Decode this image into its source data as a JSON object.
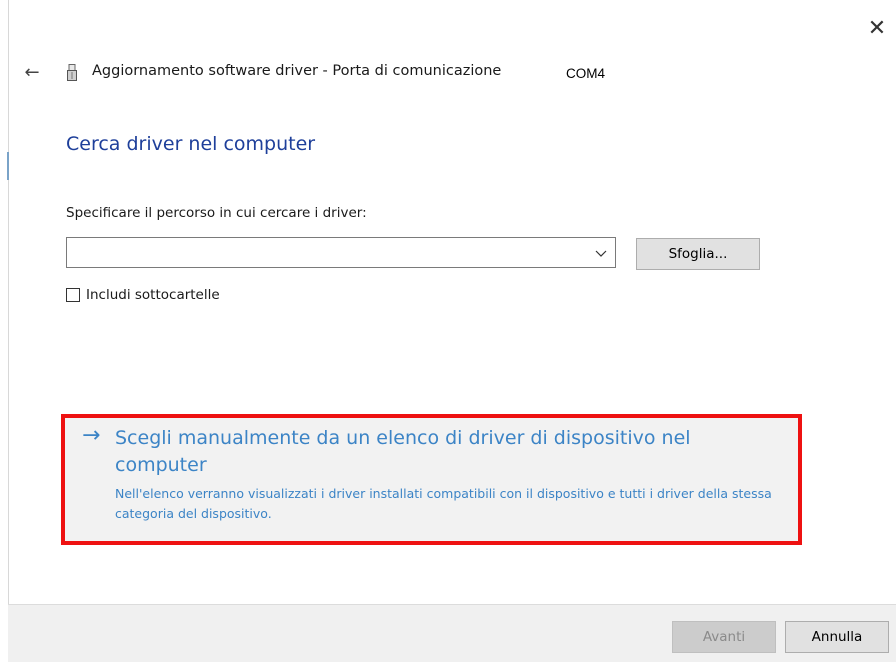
{
  "window": {
    "close_icon": "close-icon",
    "back_icon": "back-arrow-icon",
    "device_icon": "port-connector-icon",
    "title": "Aggiornamento software driver - Porta di comunicazione",
    "title_suffix": "COM4"
  },
  "content": {
    "heading": "Cerca driver nel computer",
    "path_label": "Specificare il percorso in cui cercare i driver:",
    "path_value": "",
    "browse_label": "Sfoglia...",
    "include_subfolders_label": "Includi sottocartelle",
    "include_subfolders_checked": false
  },
  "manual_option": {
    "arrow": "→",
    "title": "Scegli manualmente da un elenco di driver di dispositivo nel computer",
    "description": "Nell'elenco verranno visualizzati i driver installati compatibili con il dispositivo e tutti i driver della stessa categoria del dispositivo.",
    "highlight_color": "#ee1111"
  },
  "footer": {
    "next_label": "Avanti",
    "next_enabled": false,
    "cancel_label": "Annulla"
  },
  "colors": {
    "heading": "#1e3f9a",
    "link": "#3c84c6",
    "footer_bg": "#f0f0f0"
  }
}
